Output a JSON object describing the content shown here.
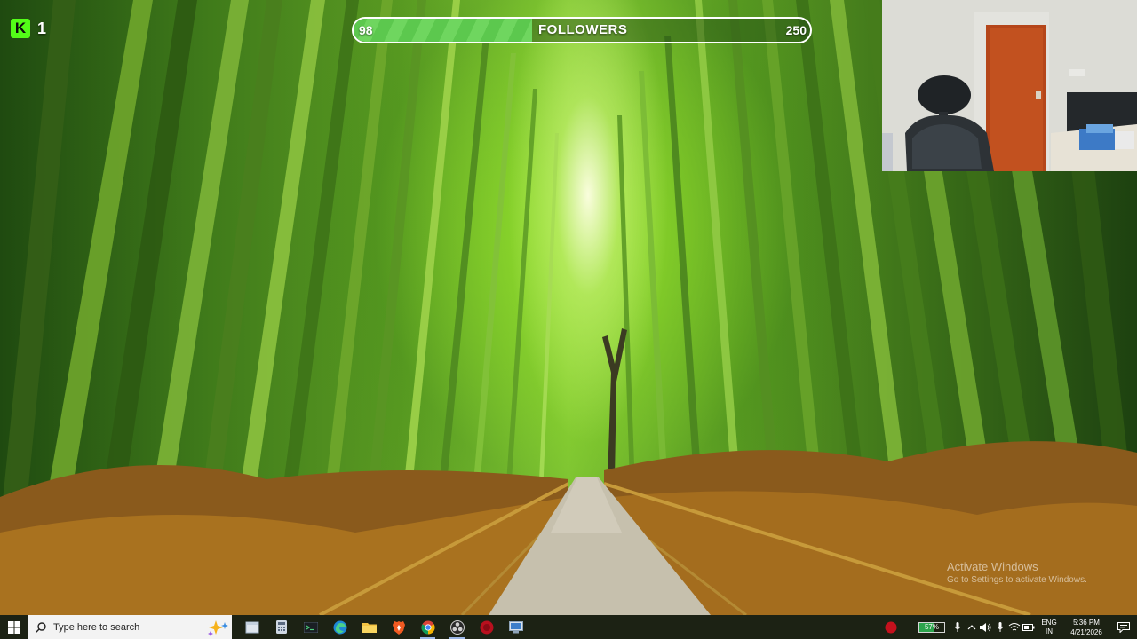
{
  "overlay": {
    "kick_logo_letter": "K",
    "kick_count": "1",
    "goal": {
      "current": "98",
      "label": "FOLLOWERS",
      "target": "250",
      "progress": 0.392
    }
  },
  "watermark": {
    "title": "Activate Windows",
    "subtitle": "Go to Settings to activate Windows."
  },
  "taskbar": {
    "search_placeholder": "Type here to search",
    "pinned_apps": [
      {
        "name": "file-explorer-window-icon",
        "active": false
      },
      {
        "name": "calculator-icon",
        "active": false
      },
      {
        "name": "terminal-icon",
        "active": false
      },
      {
        "name": "edge-icon",
        "active": false
      },
      {
        "name": "folder-icon",
        "active": false
      },
      {
        "name": "brave-icon",
        "active": false
      },
      {
        "name": "chrome-icon",
        "active": true
      },
      {
        "name": "obs-icon",
        "active": true
      },
      {
        "name": "record-app-icon",
        "active": false
      },
      {
        "name": "remote-desktop-icon",
        "active": false
      }
    ],
    "tray": {
      "battery": "57%",
      "battery_level": 0.57,
      "language_top": "ENG",
      "language_bottom": "IN",
      "time": "5:36 PM",
      "date": "4/21/2026"
    }
  },
  "colors": {
    "kick_green": "#53fc18",
    "goal_fill": "#5cc84e",
    "taskbar_bg": "#1c2214"
  }
}
